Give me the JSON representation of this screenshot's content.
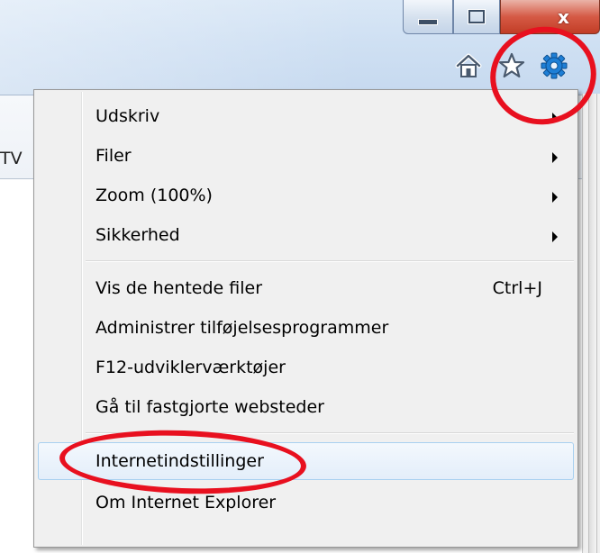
{
  "window": {
    "minimize_label": "",
    "maximize_label": "",
    "close_label": "x"
  },
  "toolbar": {
    "icons": [
      "home-icon",
      "star-icon",
      "gear-icon"
    ]
  },
  "background": {
    "tab_fragment": "TV"
  },
  "menu": {
    "items": [
      {
        "label": "Udskriv",
        "submenu": true
      },
      {
        "label": "Filer",
        "submenu": true
      },
      {
        "label": "Zoom (100%)",
        "submenu": true
      },
      {
        "label": "Sikkerhed",
        "submenu": true
      },
      {
        "label": "Vis de hentede filer",
        "shortcut": "Ctrl+J"
      },
      {
        "label": "Administrer tilføjelsesprogrammer"
      },
      {
        "label": "F12-udviklerværktøjer"
      },
      {
        "label": "Gå til fastgjorte websteder"
      },
      {
        "label": "Internetindstillinger",
        "highlighted": true
      },
      {
        "label": "Om Internet Explorer"
      }
    ]
  },
  "colors": {
    "annotation": "#e8101f",
    "gear": "#1e7fd6",
    "highlight_border": "#a8d0f0"
  }
}
